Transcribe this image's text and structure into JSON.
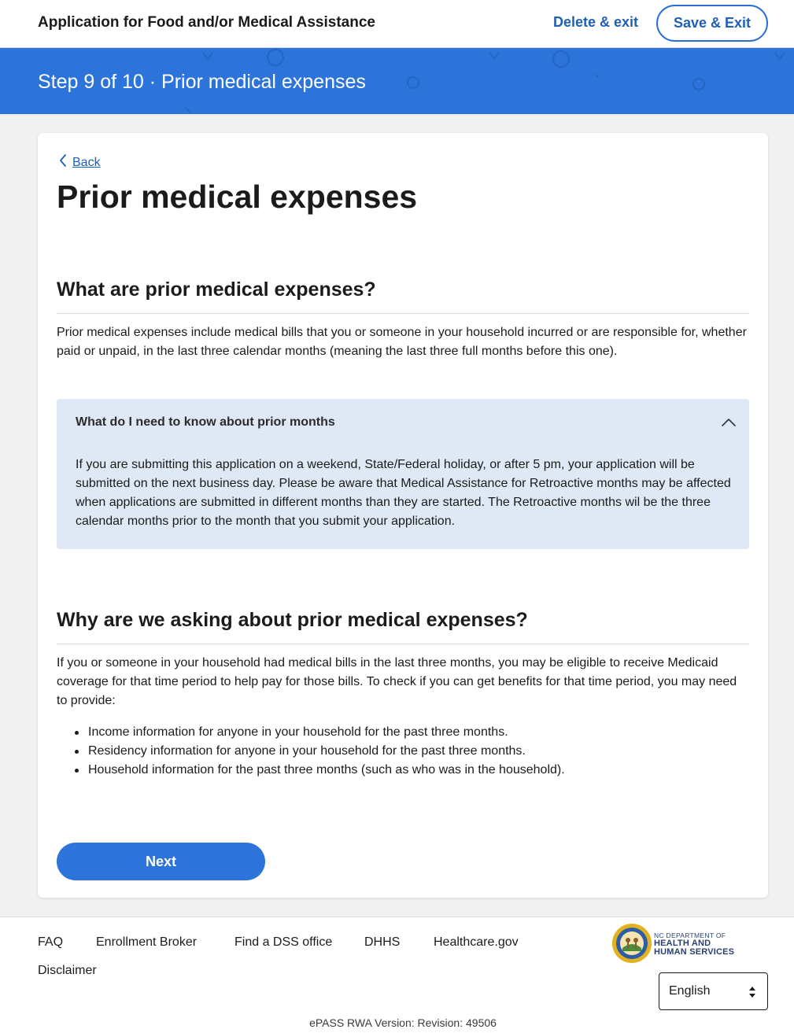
{
  "header": {
    "app_title": "Application for Food and/or Medical Assistance",
    "delete_exit_label": "Delete & exit",
    "save_exit_label": "Save & Exit"
  },
  "step_banner": {
    "text": "Step 9 of 10 · Prior medical expenses"
  },
  "content": {
    "back_label": "Back",
    "page_title": "Prior medical expenses",
    "section1": {
      "heading": "What are prior medical expenses?",
      "body": "Prior medical expenses include medical bills that you or someone in your household incurred or are responsible for, whether paid or unpaid, in the last three calendar months (meaning the last three full months before this one)."
    },
    "accordion": {
      "title": "What do I need to know about prior months",
      "expanded": true,
      "body": "If you are submitting this application on a weekend, State/Federal holiday, or after 5 pm, your application will be submitted on the next business day. Please be aware that Medical Assistance for Retroactive months may be affected when applications are submitted in different months than they are started. The Retroactive months wil be the three calendar months prior to the month that you submit your application."
    },
    "section2": {
      "heading": "Why are we asking about prior medical expenses?",
      "body": "If you or someone in your household had medical bills in the last three months, you may be eligible to receive Medicaid coverage for that time period to help pay for those bills. To check if you can get benefits for that time period, you may need to provide:",
      "bullets": [
        "Income information for anyone in your household for the past three months.",
        "Residency information for anyone in your household for the past three months.",
        "Household information for the past three months (such as who was in the household)."
      ]
    },
    "next_label": "Next"
  },
  "footer": {
    "links": [
      "FAQ",
      "Enrollment Broker",
      "Find a DSS office",
      "DHHS",
      "Healthcare.gov",
      "Disclaimer"
    ],
    "logo_line1": "NC DEPARTMENT OF",
    "logo_line2": "HEALTH AND",
    "logo_line3": "HUMAN SERVICES",
    "language_selected": "English",
    "version": "ePASS RWA Version: Revision: 49506"
  },
  "colors": {
    "brand_blue": "#2d74da",
    "link_blue": "#1f5fb8",
    "accordion_bg": "#dfe9f6",
    "page_bg": "#f1f1f1"
  },
  "icons": {
    "back": "chevron-left-icon",
    "accordion_toggle": "chevron-up-icon",
    "select_arrows": "sort-arrows-icon"
  }
}
